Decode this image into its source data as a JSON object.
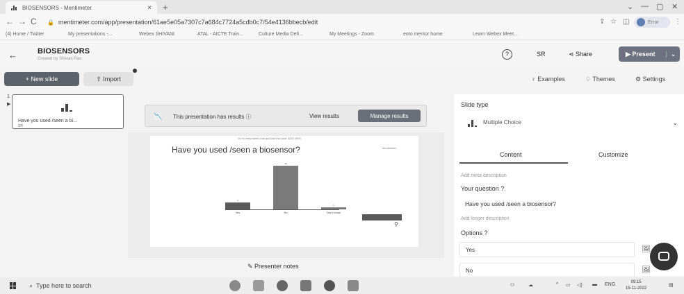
{
  "browser": {
    "tab_title": "BIOSENSORS - Mentimeter",
    "tab_close": "×",
    "new_tab": "+",
    "url": "mentimeter.com/app/presentation/61ae5e05a7307c7a684c7724a5cdb0c7/54e4136bbecb/edit",
    "profile_label": "Error",
    "bookmarks": [
      "(4) Home / Twitter",
      "My presentations -...",
      "Webex SHIVANI",
      "ATAL - AICTE Train...",
      "Culture Media Defi...",
      "My Meetings - Zoom",
      "eoto mentor home",
      "Learn Webex Meet..."
    ]
  },
  "header": {
    "title": "BIOSENSORS",
    "subtitle": "Created by Shivani Rao",
    "sr": "SR",
    "share": "Share",
    "present": "Present"
  },
  "toolbar": {
    "new_slide": "+ New slide",
    "import": "Import",
    "examples": "Examples",
    "themes": "Themes",
    "settings": "Settings"
  },
  "thumbnail": {
    "number": "1",
    "question": "Have you used /seen a bi...",
    "initials": "SR"
  },
  "banner": {
    "message": "This presentation has results",
    "view_results": "View results",
    "manage_results": "Manage results"
  },
  "slide": {
    "join_text": "Go to www.menti.com and use the code 3219 1509",
    "question": "Have you used /seen a biosensor?",
    "brand": "Mentimeter",
    "presenter_notes": "Presenter notes"
  },
  "chart_data": {
    "type": "bar",
    "categories": [
      "Yes",
      "No",
      "Don't know"
    ],
    "values": [
      3,
      19,
      1
    ],
    "ylim": [
      0,
      20
    ],
    "grid": false
  },
  "panel": {
    "slide_type_label": "Slide type",
    "slide_type_value": "Multiple Choice",
    "tab_content": "Content",
    "tab_customize": "Customize",
    "add_meta": "Add meta description",
    "question_label": "Your question ?",
    "question_value": "Have you used /seen a biosensor?",
    "add_longer": "Add longer description",
    "options_label": "Options ?",
    "options": [
      "Yes",
      "No"
    ]
  },
  "taskbar": {
    "search_placeholder": "Type here to search",
    "lang": "ENG",
    "time": "09:15",
    "date": "15-11-2022"
  }
}
